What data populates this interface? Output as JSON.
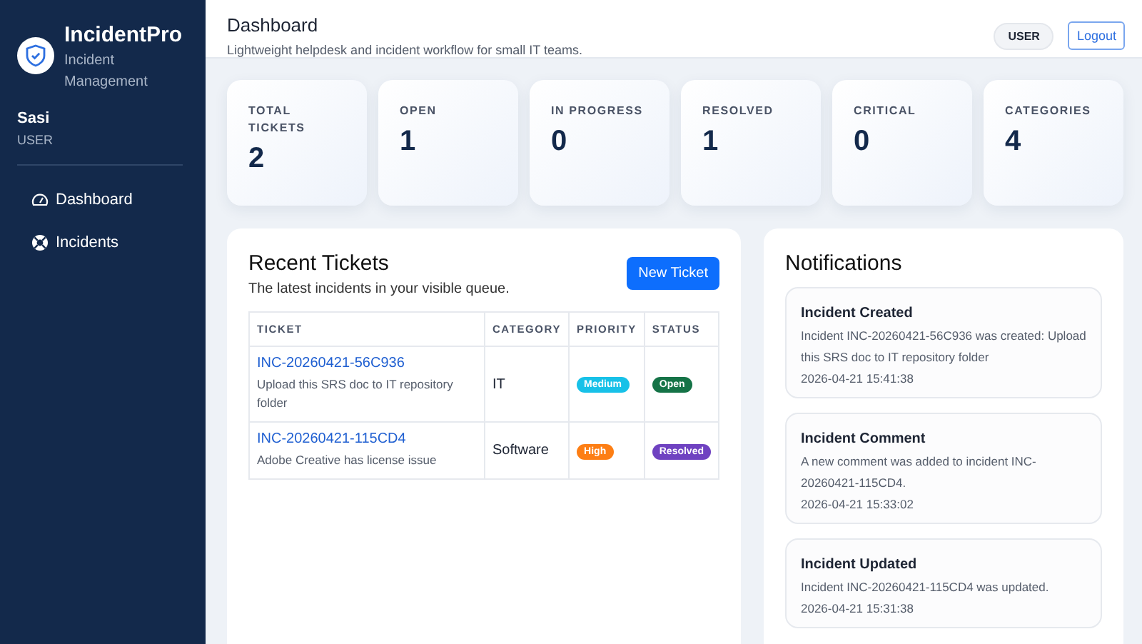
{
  "sidebar": {
    "brand": "IncidentPro",
    "subtitle": "Incident Management",
    "user": {
      "name": "Sasi",
      "role": "USER"
    },
    "items": [
      {
        "label": "Dashboard",
        "kind": "gauge"
      },
      {
        "label": "Incidents",
        "kind": "lifebuoy"
      }
    ]
  },
  "header": {
    "title": "Dashboard",
    "subtitle": "Lightweight helpdesk and incident workflow for small IT teams.",
    "role_badge": "USER",
    "logout": "Logout"
  },
  "stats": [
    {
      "label": "TOTAL TICKETS",
      "value": "2"
    },
    {
      "label": "OPEN",
      "value": "1"
    },
    {
      "label": "IN PROGRESS",
      "value": "0"
    },
    {
      "label": "RESOLVED",
      "value": "1"
    },
    {
      "label": "CRITICAL",
      "value": "0"
    },
    {
      "label": "CATEGORIES",
      "value": "4"
    }
  ],
  "recent_tickets": {
    "title": "Recent Tickets",
    "subtitle": "The latest incidents in your visible queue.",
    "new_button": "New Ticket",
    "columns": [
      "TICKET",
      "CATEGORY",
      "PRIORITY",
      "STATUS"
    ],
    "rows": [
      {
        "id": "INC-20260421-56C936",
        "summary": "Upload this SRS doc to IT repository folder",
        "category": "IT",
        "priority": {
          "label": "Medium",
          "color": "#17c1e8"
        },
        "status": {
          "label": "Open",
          "color": "#157347"
        }
      },
      {
        "id": "INC-20260421-115CD4",
        "summary": "Adobe Creative has license issue",
        "category": "Software",
        "priority": {
          "label": "High",
          "color": "#fd7e14"
        },
        "status": {
          "label": "Resolved",
          "color": "#6f42c1"
        }
      }
    ]
  },
  "notifications": {
    "title": "Notifications",
    "items": [
      {
        "title": "Incident Created",
        "message": "Incident INC-20260421-56C936 was created: Upload this SRS doc to IT repository folder",
        "time": "2026-04-21 15:41:38"
      },
      {
        "title": "Incident Comment",
        "message": "A new comment was added to incident INC-20260421-115CD4.",
        "time": "2026-04-21 15:33:02"
      },
      {
        "title": "Incident Updated",
        "message": "Incident INC-20260421-115CD4 was updated.",
        "time": "2026-04-21 15:31:38"
      }
    ]
  }
}
